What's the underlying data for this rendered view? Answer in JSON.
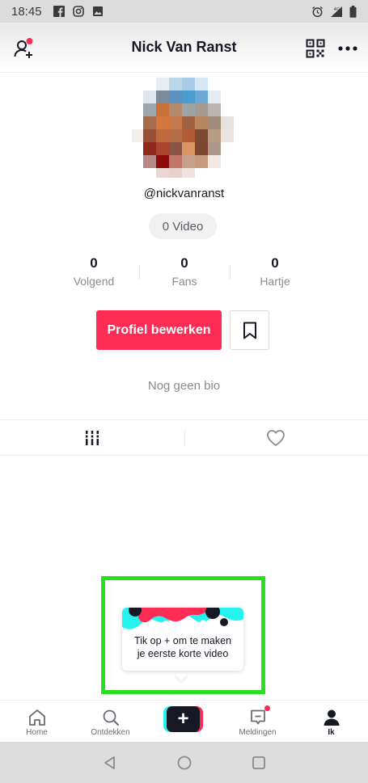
{
  "status_bar": {
    "time": "18:45",
    "icons": [
      "facebook-icon",
      "instagram-icon",
      "image-icon"
    ],
    "right_icons": [
      "alarm-icon",
      "signal-4g-icon",
      "battery-icon"
    ]
  },
  "header": {
    "title": "Nick Van Ranst",
    "left_icon": "add-friend-icon",
    "right_icons": [
      "qr-code-icon",
      "more-icon"
    ]
  },
  "profile": {
    "handle": "@nickvanranst",
    "video_count": "0 Video",
    "stats": [
      {
        "value": "0",
        "label": "Volgend"
      },
      {
        "value": "0",
        "label": "Fans"
      },
      {
        "value": "0",
        "label": "Hartje"
      }
    ],
    "edit_button": "Profiel bewerken",
    "bio": "Nog geen bio"
  },
  "tabs": [
    "grid-icon",
    "heart-icon"
  ],
  "tooltip": {
    "line1": "Tik op + om te maken",
    "line2": "je eerste korte video"
  },
  "bottom_nav": [
    {
      "label": "Home",
      "icon": "home-icon"
    },
    {
      "label": "Ontdekken",
      "icon": "search-icon"
    },
    {
      "label": "",
      "icon": "plus-icon"
    },
    {
      "label": "Meldingen",
      "icon": "inbox-icon"
    },
    {
      "label": "Ik",
      "icon": "profile-icon"
    }
  ],
  "colors": {
    "accent": "#fe2c55",
    "cyan": "#25f4ee",
    "highlight": "#28e01f"
  }
}
